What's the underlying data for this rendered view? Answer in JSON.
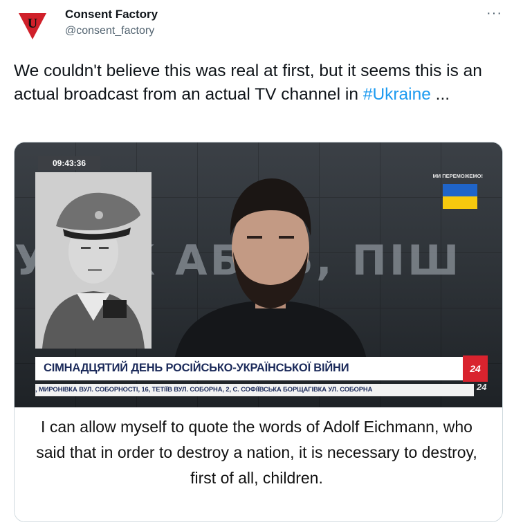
{
  "tweet": {
    "author": {
      "display_name": "Consent Factory",
      "handle": "@consent_factory",
      "avatar_letter": "U"
    },
    "more_icon": "···",
    "text_main": "We couldn't believe this was real at first, but it seems this is an actual broadcast from an actual TV channel in ",
    "hashtag": "#Ukraine",
    "text_suffix": " ..."
  },
  "media": {
    "timestamp": "09:43:36",
    "slogan": "МИ ПЕРЕМОЖЕМО!",
    "background_text": "У     Й К  АБЛЬ, ПІШ",
    "lower_third_title": "СІМНАДЦЯТИЙ ДЕНЬ РОСІЙСЬКО-УКРАЇНСЬКОЇ ВІЙНИ",
    "channel_logo": "24",
    "ticker_text": ", МИРОНІВКА ВУЛ. СОБОРНОСТІ, 16, ТЕТІЇВ ВУЛ. СОБОРНА, 2, С. СОФІЇВСЬКА БОРЩАГІВКА УЛ. СОБОРНА",
    "ticker_logo": "24",
    "caption": "I can allow myself to quote the words of Adolf Eichmann, who said that in order to destroy a nation, it is necessary to destroy, first of all, children."
  },
  "colors": {
    "hashtag": "#1d9bf0",
    "secondary_text": "#536471",
    "avatar_red": "#d0202a",
    "flag_blue": "#1f64c8",
    "flag_yellow": "#f6c90e"
  }
}
